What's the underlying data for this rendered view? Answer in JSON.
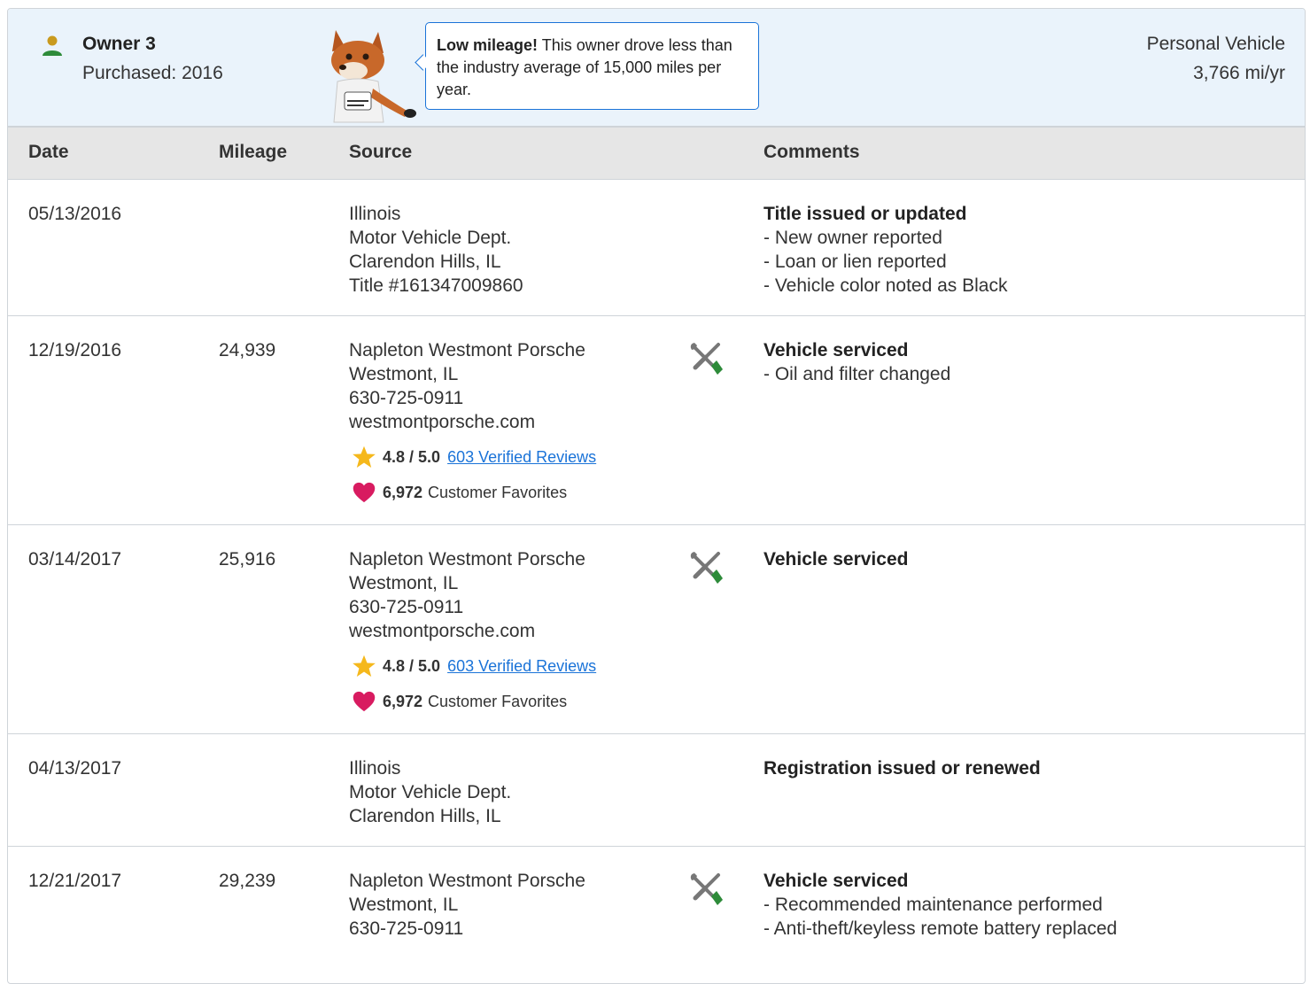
{
  "owner": {
    "name": "Owner 3",
    "purchased": "Purchased: 2016",
    "vehicle_type": "Personal Vehicle",
    "miles_per_year": "3,766 mi/yr",
    "callout": {
      "emphasis": "Low mileage!",
      "text": " This owner drove less than the industry average of 15,000 miles per year."
    },
    "colors": {
      "accent": "#1a73d8",
      "header_bg": "#eaf3fb"
    }
  },
  "table": {
    "headers": {
      "date": "Date",
      "mileage": "Mileage",
      "source": "Source",
      "comments": "Comments"
    },
    "rows": [
      {
        "date": "05/13/2016",
        "mileage": "",
        "source": [
          "Illinois",
          "Motor Vehicle Dept.",
          "Clarendon Hills, IL",
          "Title #161347009860"
        ],
        "service_icon": false,
        "comment_title": "Title issued or updated",
        "comment_lines": [
          "- New owner reported",
          "- Loan or lien reported",
          "- Vehicle color noted as Black"
        ]
      },
      {
        "date": "12/19/2016",
        "mileage": "24,939",
        "source": [
          "Napleton Westmont Porsche",
          "Westmont, IL",
          "630-725-0911",
          "westmontporsche.com"
        ],
        "rating": "4.8 / 5.0",
        "reviews": "603 Verified Reviews",
        "favorites_count": "6,972",
        "favorites_label": "Customer Favorites",
        "service_icon": true,
        "comment_title": "Vehicle serviced",
        "comment_lines": [
          "- Oil and filter changed"
        ]
      },
      {
        "date": "03/14/2017",
        "mileage": "25,916",
        "source": [
          "Napleton Westmont Porsche",
          "Westmont, IL",
          "630-725-0911",
          "westmontporsche.com"
        ],
        "rating": "4.8 / 5.0",
        "reviews": "603 Verified Reviews",
        "favorites_count": "6,972",
        "favorites_label": "Customer Favorites",
        "service_icon": true,
        "comment_title": "Vehicle serviced",
        "comment_lines": []
      },
      {
        "date": "04/13/2017",
        "mileage": "",
        "source": [
          "Illinois",
          "Motor Vehicle Dept.",
          "Clarendon Hills, IL"
        ],
        "service_icon": false,
        "comment_title": "Registration issued or renewed",
        "comment_lines": []
      },
      {
        "date": "12/21/2017",
        "mileage": "29,239",
        "source": [
          "Napleton Westmont Porsche",
          "Westmont, IL",
          "630-725-0911"
        ],
        "service_icon": true,
        "comment_title": "Vehicle serviced",
        "comment_lines": [
          "- Recommended maintenance performed",
          "- Anti-theft/keyless remote battery replaced"
        ]
      }
    ]
  },
  "icons": {
    "owner": "person-icon",
    "mascot": "carfox-mascot",
    "service": "wrench-screwdriver-icon",
    "rating": "star-icon",
    "favorites": "heart-icon"
  }
}
